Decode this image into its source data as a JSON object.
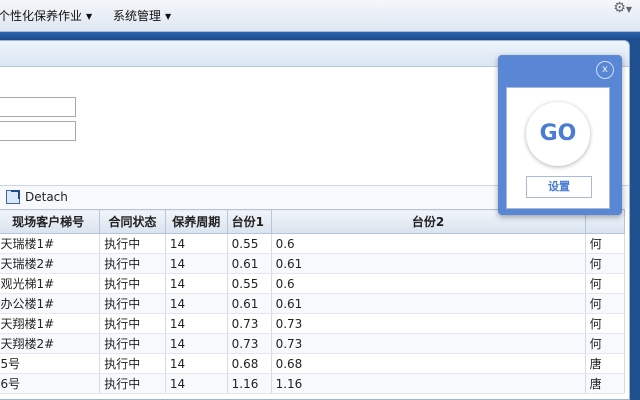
{
  "menu": {
    "items": [
      {
        "label": "个性化保养作业"
      },
      {
        "label": "系统管理"
      }
    ],
    "gear_icon": "gear-icon"
  },
  "toolbar": {
    "detach_label": "Detach"
  },
  "table": {
    "columns": [
      "现场客户梯号",
      "合同状态",
      "保养周期",
      "台份1",
      "台份2",
      ""
    ],
    "rows": [
      [
        "天瑞楼1#",
        "执行中",
        "14",
        "0.55",
        "0.6",
        "何"
      ],
      [
        "天瑞楼2#",
        "执行中",
        "14",
        "0.61",
        "0.61",
        "何"
      ],
      [
        "观光梯1#",
        "执行中",
        "14",
        "0.55",
        "0.6",
        "何"
      ],
      [
        "办公楼1#",
        "执行中",
        "14",
        "0.61",
        "0.61",
        "何"
      ],
      [
        "天翔楼1#",
        "执行中",
        "14",
        "0.73",
        "0.73",
        "何"
      ],
      [
        "天翔楼2#",
        "执行中",
        "14",
        "0.73",
        "0.73",
        "何"
      ],
      [
        "5号",
        "执行中",
        "14",
        "0.68",
        "0.68",
        "唐"
      ],
      [
        "6号",
        "执行中",
        "14",
        "1.16",
        "1.16",
        "唐"
      ]
    ]
  },
  "widget": {
    "close_label": "x",
    "go_label": "GO",
    "settings_label": "设置"
  }
}
